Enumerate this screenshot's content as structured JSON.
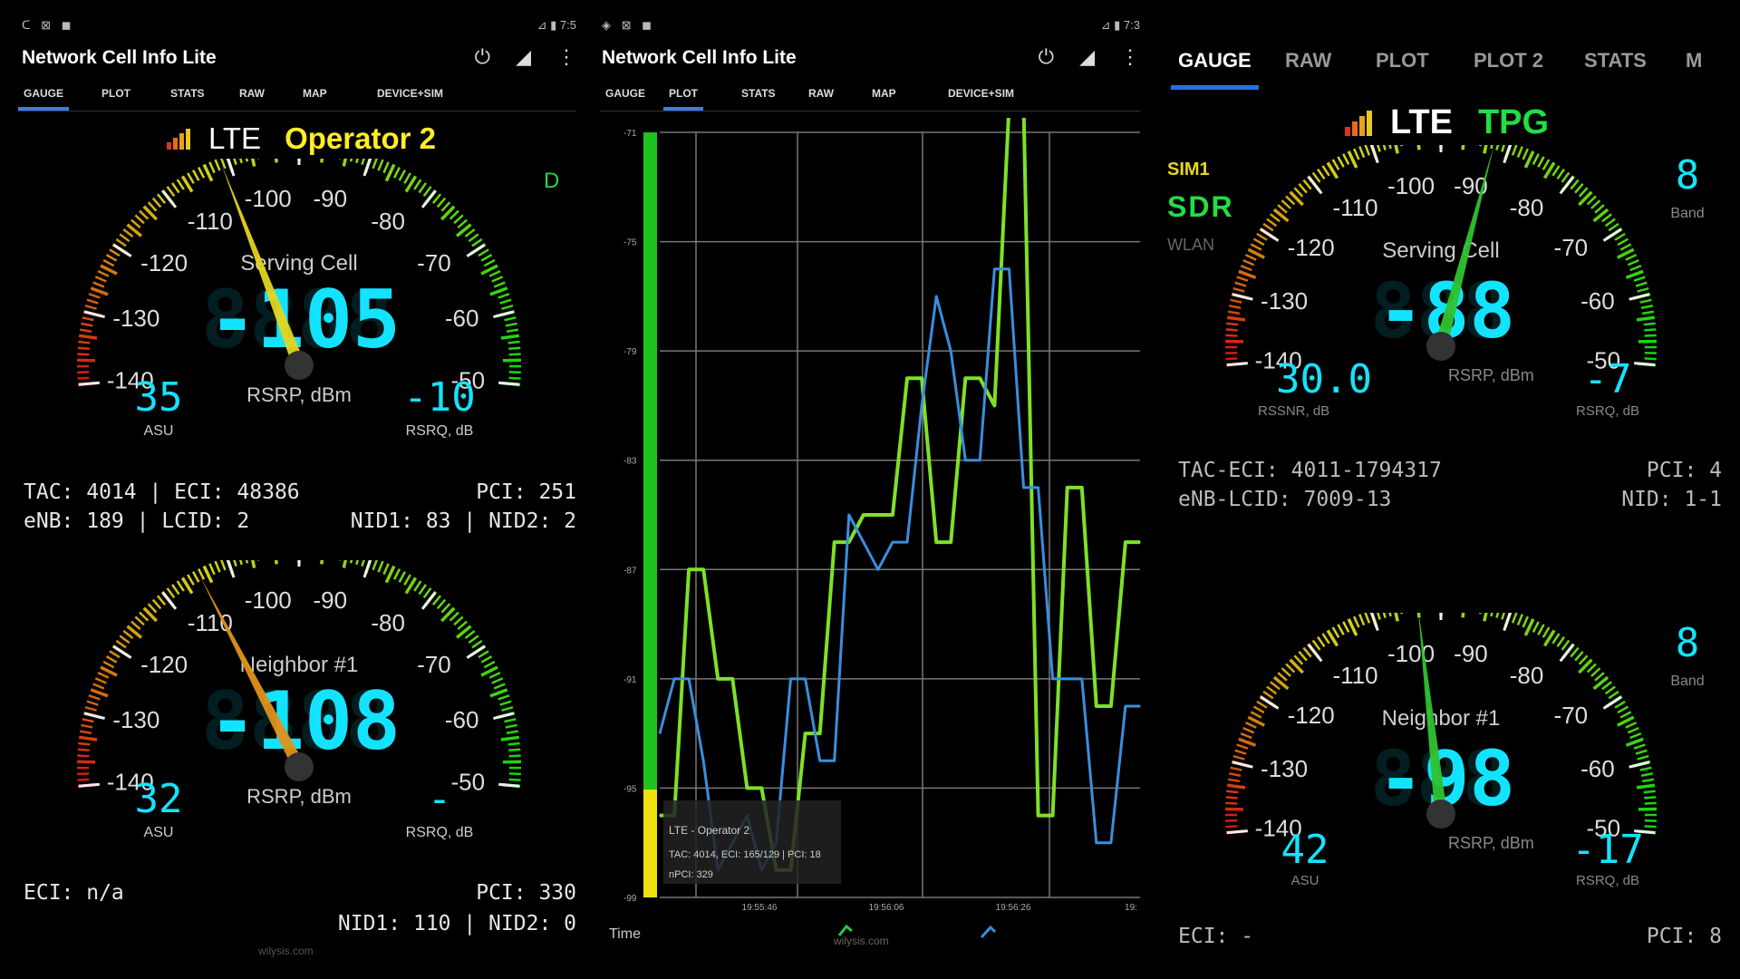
{
  "colors": {
    "lcd": "#14e3ff",
    "accent": "#3b7de6",
    "operator": "#ffee22",
    "tpg": "#22dd44",
    "needle_serving": "#e5d41e",
    "needle_neighbor": "#e0901a",
    "needle_green": "#2fc22f",
    "plot_green": "#7fe028",
    "plot_blue": "#3a8ee0"
  },
  "p1": {
    "status_left": "ᑕ ⊠ ◼",
    "status_right": "⊿ ▮ 7:5",
    "title": "Network Cell Info Lite",
    "icons": [
      "power-icon",
      "signal-icon",
      "more-vert-icon"
    ],
    "tabs": [
      "GAUGE",
      "PLOT",
      "STATS",
      "RAW",
      "MAP",
      "DEVICE+SIM"
    ],
    "tech": "LTE",
    "operator": "Operator 2",
    "corner_letter": "D",
    "serving": {
      "label": "Serving Cell",
      "value": "-105",
      "unit": "RSRP, dBm",
      "asu": "35",
      "asu_label": "ASU",
      "rsrq": "-10",
      "rsrq_label": "RSRQ, dB",
      "needle_dbm": -105
    },
    "serving_info": {
      "l1": "TAC: 4014 | ECI: 48386",
      "r1": "PCI: 251",
      "l2": "eNB: 189 | LCID: 2",
      "r2": "NID1: 83 | NID2: 2"
    },
    "neighbor": {
      "label": "Neighbor #1",
      "value": "-108",
      "unit": "RSRP, dBm",
      "asu": "32",
      "asu_label": "ASU",
      "rsrq": "-",
      "rsrq_label": "RSRQ, dB",
      "needle_dbm": -108
    },
    "neighbor_info": {
      "l1": "ECI: n/a",
      "r1": "PCI: 330",
      "r2": "NID1: 110 | NID2: 0"
    },
    "watermark": "wilysis.com"
  },
  "p2": {
    "status_left": "◈ ⊠ ◼",
    "status_right": "⊿ ▮ 7:3",
    "title": "Network Cell Info Lite",
    "tabs": [
      "GAUGE",
      "PLOT",
      "STATS",
      "RAW",
      "MAP",
      "DEVICE+SIM"
    ],
    "y_ticks": [
      "-71",
      "-75",
      "-79",
      "-83",
      "-87",
      "-91",
      "-95",
      "-99"
    ],
    "x_ticks": [
      "19:55:46",
      "19:56:06",
      "19:56:26",
      "19:"
    ],
    "x_label": "Time",
    "legend": {
      "l1": "LTE - Operator 2",
      "l2": "TAC: 4014, ECI: 165/129 | PCI: 18",
      "l3": "nPCI: 329"
    },
    "footer_mark": "wilysis.com"
  },
  "p3": {
    "tabs": [
      "GAUGE",
      "RAW",
      "PLOT",
      "PLOT 2",
      "STATS",
      "M"
    ],
    "tech": "LTE",
    "operator": "TPG",
    "sim": "SIM1",
    "sdr": "SDR",
    "wlan": "WLAN",
    "serving": {
      "label": "Serving Cell",
      "value": "-88",
      "unit": "RSRP, dBm",
      "sinr": "30.0",
      "sinr_label": "RSSNR, dB",
      "rsrq": "-7",
      "rsrq_label": "RSRQ, dB",
      "band": "8",
      "band_label": "Band",
      "needle_dbm": -88
    },
    "serving_info": {
      "l1": "TAC-ECI: 4011-1794317",
      "r1": "PCI: 4",
      "l2": "eNB-LCID: 7009-13",
      "r2": "NID: 1-1"
    },
    "neighbor": {
      "label": "Neighbor #1",
      "value": "-98",
      "unit": "RSRP, dBm",
      "asu": "42",
      "asu_label": "ASU",
      "rsrq": "-17",
      "rsrq_label": "RSRQ, dB",
      "band": "8",
      "band_label": "Band",
      "needle_dbm": -98
    },
    "neighbor_info": {
      "l1": "ECI: -",
      "r1": "PCI: 8"
    }
  },
  "gauge_scale": [
    "-140",
    "-130",
    "-120",
    "-110",
    "-100",
    "-90",
    "-80",
    "-70",
    "-60",
    "-50"
  ],
  "chart_data": {
    "type": "line",
    "xlabel": "Time",
    "ylim": [
      -99,
      -71
    ],
    "x_ticks": [
      "19:55:46",
      "19:56:06",
      "19:56:26"
    ],
    "series": [
      {
        "values": [
          -96,
          -96,
          -87,
          -87,
          -91,
          -91,
          -95,
          -95,
          -98,
          -98,
          -93,
          -93,
          -86,
          -86,
          -85,
          -85,
          -85,
          -80,
          -80,
          -86,
          -86,
          -80,
          -80,
          -81,
          -70,
          -70,
          -96,
          -96,
          -84,
          -84,
          -92,
          -92,
          -86,
          -86
        ]
      },
      {
        "values": [
          -93,
          -91,
          -91,
          -94,
          -98,
          -97,
          -96,
          -98,
          -97,
          -91,
          -91,
          -94,
          -94,
          -85,
          -86,
          -87,
          -86,
          -86,
          -81,
          -77,
          -79,
          -83,
          -83,
          -76,
          -76,
          -84,
          -84,
          -91,
          -91,
          -91,
          -97,
          -97,
          -92,
          -92
        ]
      }
    ]
  }
}
